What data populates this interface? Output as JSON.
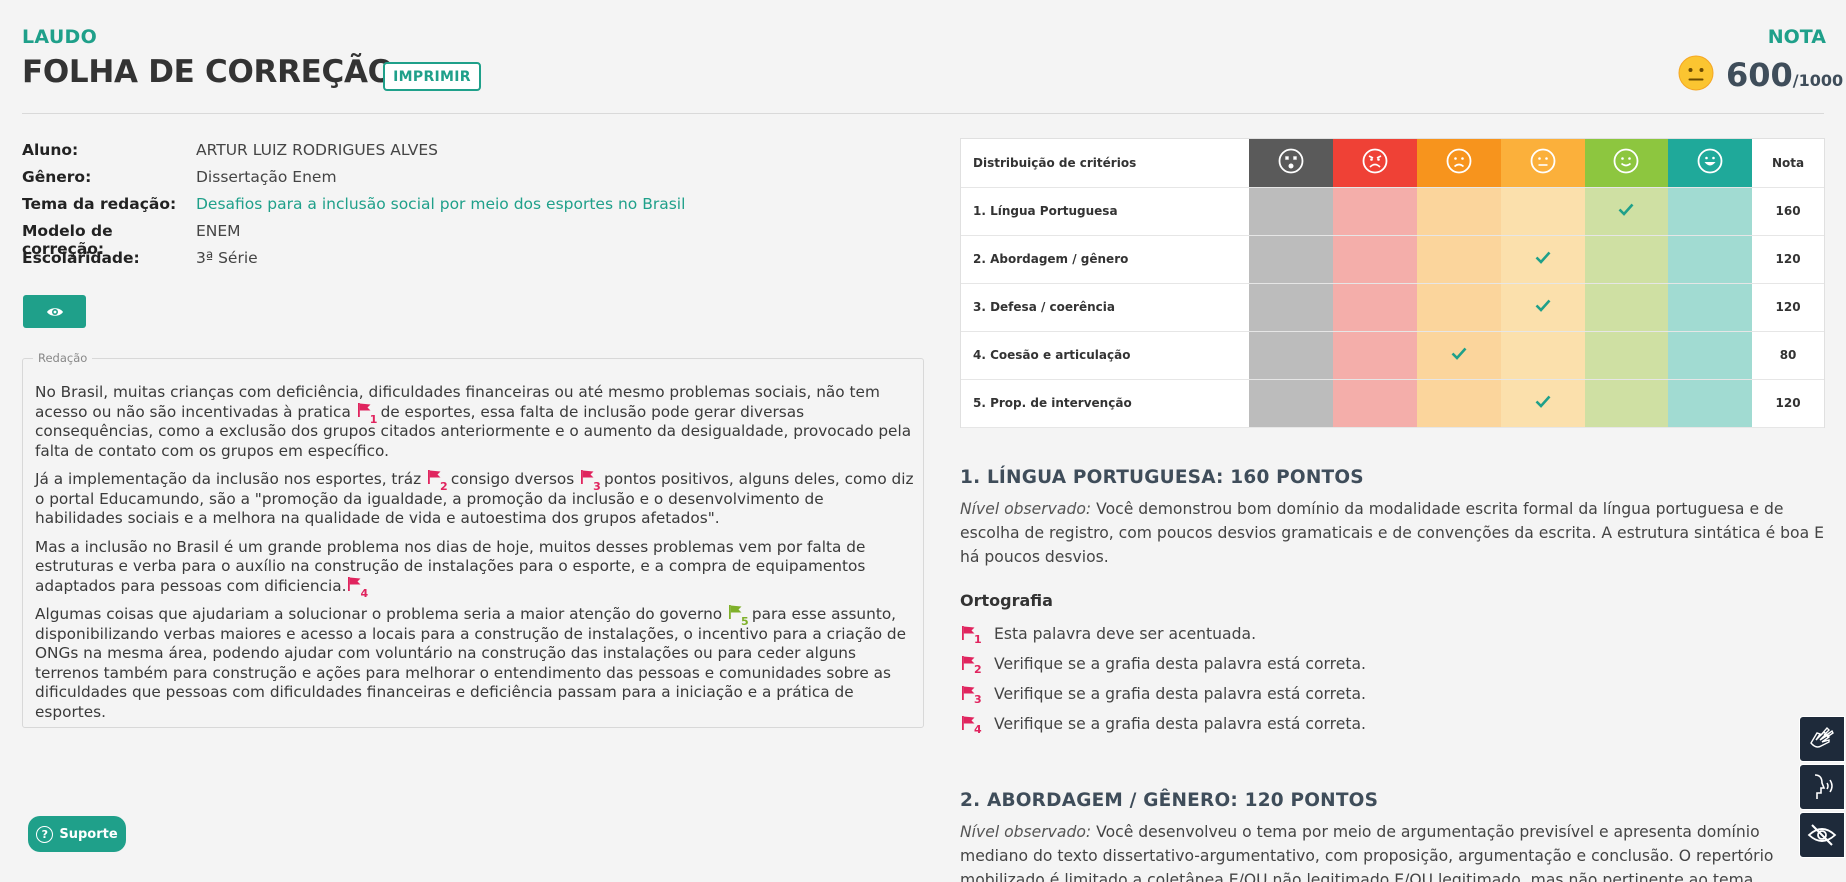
{
  "header": {
    "section_label": "LAUDO",
    "title": "FOLHA DE CORREÇÃO",
    "print_button": "IMPRIMIR",
    "score_label": "NOTA",
    "score": "600",
    "score_max": "/1000"
  },
  "student": {
    "labels": [
      "Aluno:",
      "Gênero:",
      "Tema da redação:",
      "Modelo de correção:",
      "Escolaridade:"
    ],
    "values": [
      "ARTUR LUIZ RODRIGUES ALVES",
      "Dissertação Enem",
      "Desafios para a inclusão social por meio dos esportes no Brasil",
      "ENEM",
      "3ª Série"
    ]
  },
  "essay": {
    "legend": "Redação",
    "p1a": "No Brasil, muitas crianças com deficiência, dificuldades financeiras ou até mesmo problemas sociais, não tem acesso ou não são incentivadas à pratica",
    "p1b": "de esportes, essa falta de inclusão pode gerar diversas consequências, como a exclusão dos grupos citados anteriormente e o aumento da desigualdade, provocado pela falta de contato com os grupos em específico.",
    "p2a": "Já a implementação da inclusão nos esportes, tráz",
    "p2b": "consigo dversos",
    "p2c": "pontos positivos, alguns deles, como diz o portal Educamundo, são a \"promoção da igualdade, a promoção da inclusão e o desenvolvimento de habilidades sociais e a melhora na qualidade de vida e autoestima dos grupos afetados\".",
    "p3": "Mas a inclusão no Brasil é um grande problema nos dias de hoje, muitos desses problemas vem por falta de estruturas e verba para o auxílio na construção de instalações para o esporte, e a compra de equipamentos adaptados para pessoas com dificiencia.",
    "p4a": "Algumas coisas que ajudariam a solucionar o problema seria a maior atenção do governo",
    "p4b": "para esse assunto, disponibilizando verbas maiores e acesso a locais para a construção de instalações, o incentivo para a criação de ONGs na mesma área, podendo ajudar com voluntário na construção das instalações ou para ceder alguns terrenos também para construção e ações para melhorar o entendimento das pessoas e comunidades sobre as dificuldades que pessoas com dificuldades financeiras e deficiência passam para a iniciação e a prática de esportes.",
    "flag_numbers": [
      "1",
      "2",
      "3",
      "4",
      "5"
    ]
  },
  "support_button": "Suporte",
  "criteria_table": {
    "header_label": "Distribuição de critérios",
    "nota_header": "Nota",
    "level_faces": [
      "dead-face-icon",
      "angry-face-icon",
      "sad-face-icon",
      "neutral-face-icon",
      "smile-face-icon",
      "grin-face-icon"
    ],
    "rows": [
      {
        "name": "1. Língua Portuguesa",
        "level": 4,
        "score": "160"
      },
      {
        "name": "2. Abordagem / gênero",
        "level": 3,
        "score": "120"
      },
      {
        "name": "3. Defesa / coerência",
        "level": 3,
        "score": "120"
      },
      {
        "name": "4. Coesão e articulação",
        "level": 2,
        "score": "80"
      },
      {
        "name": "5. Prop. de intervenção",
        "level": 3,
        "score": "120"
      }
    ]
  },
  "feedback": {
    "s1_title": "1. LÍNGUA PORTUGUESA: 160 PONTOS",
    "s1_observed": "Nível observado:",
    "s1_text": "Você demonstrou bom domínio da modalidade escrita formal da língua portuguesa e de escolha de registro, com poucos desvios gramaticais e de convenções da escrita. A estrutura sintática é boa E há poucos desvios.",
    "s1_sub": "Ortografia",
    "s1_errors": [
      {
        "n": "1",
        "text": "Esta palavra deve ser acentuada."
      },
      {
        "n": "2",
        "text": "Verifique se a grafia desta palavra está correta."
      },
      {
        "n": "3",
        "text": "Verifique se a grafia desta palavra está correta."
      },
      {
        "n": "4",
        "text": "Verifique se a grafia desta palavra está correta."
      }
    ],
    "s2_title": "2. ABORDAGEM / GÊNERO: 120 PONTOS",
    "s2_observed": "Nível observado:",
    "s2_text": "Você desenvolveu o tema por meio de argumentação previsível e apresenta domínio mediano do texto dissertativo-argumentativo, com proposição, argumentação e conclusão. O repertório mobilizado é limitado a coletânea E/OU não legitimado E/OU legitimado, mas não pertinente ao tema."
  },
  "colors": {
    "accent": "#1fa08a",
    "flag_red": "#e0245e",
    "flag_green": "#7fb02a",
    "heading": "#3f4d5a"
  },
  "side_buttons": [
    "sign-language-icon",
    "audio-speech-icon",
    "hide-eye-icon"
  ]
}
